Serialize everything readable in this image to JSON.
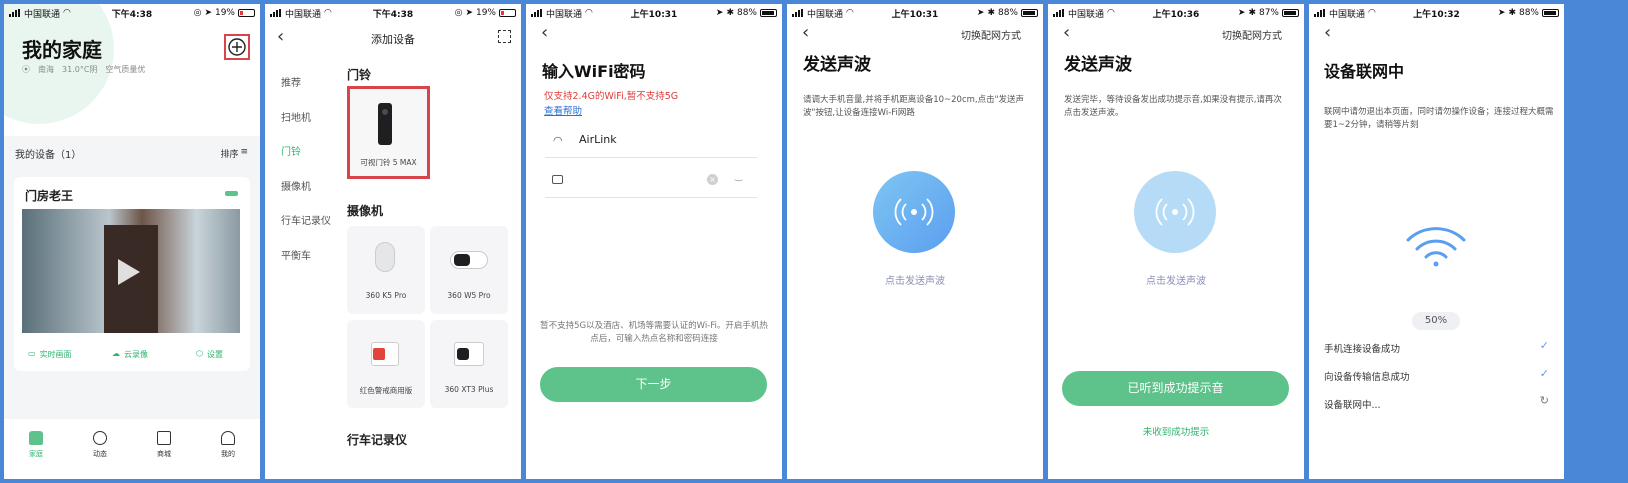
{
  "colors": {
    "accent": "#5ec38b",
    "green_text": "#2eb36e",
    "highlight": "#d9434a",
    "warning": "#e03a3a",
    "link": "#2f6fd1"
  },
  "p1": {
    "status": {
      "carrier": "中国联通",
      "time": "下午4:38",
      "battery": "19%"
    },
    "title": "我的家庭",
    "weather": {
      "city": "南海",
      "temp": "31.0°C阴",
      "air": "空气质量优"
    },
    "my_devices": "我的设备（1）",
    "sort": "排序",
    "device": {
      "name": "门房老王",
      "actions": [
        "实时画面",
        "云录像",
        "设置"
      ]
    },
    "nav": [
      "家庭",
      "动态",
      "商城",
      "我的"
    ]
  },
  "p2": {
    "status": {
      "carrier": "中国联通",
      "time": "下午4:38",
      "battery": "19%"
    },
    "title": "添加设备",
    "categories": [
      "推荐",
      "扫地机",
      "门铃",
      "摄像机",
      "行车记录仪",
      "平衡车"
    ],
    "sec_doorbell": "门铃",
    "doorbell": "可视门铃 5 MAX",
    "sec_camera": "摄像机",
    "cameras": [
      "360 K5 Pro",
      "360 W5 Pro",
      "红色警戒商用版",
      "360 XT3 Plus"
    ],
    "sec_dashcam": "行车记录仪"
  },
  "p3": {
    "status": {
      "carrier": "中国联通",
      "time": "上午10:31",
      "battery": "88%"
    },
    "title": "输入WiFi密码",
    "warn": "仅支持2.4G的WiFi,暂不支持5G",
    "help": "查看帮助",
    "ssid": "AirLink",
    "password": "",
    "note": "暂不支持5G以及酒店、机场等需要认证的Wi-Fi。开启手机热点后，可输入热点名称和密码连接",
    "next": "下一步"
  },
  "p4": {
    "status": {
      "carrier": "中国联通",
      "time": "上午10:31",
      "battery": "88%"
    },
    "switch": "切换配网方式",
    "title": "发送声波",
    "desc": "请调大手机音量,并将手机距离设备10~20cm,点击\"发送声波\"按钮,让设备连接Wi-Fi网路",
    "tap": "点击发送声波"
  },
  "p5": {
    "status": {
      "carrier": "中国联通",
      "time": "上午10:36",
      "battery": "87%"
    },
    "switch": "切换配网方式",
    "title": "发送声波",
    "desc": "发送完毕，等待设备发出成功提示音,如果没有提示,请再次点击发送声波。",
    "tap": "点击发送声波",
    "heard": "已听到成功提示音",
    "not_heard": "未收到成功提示"
  },
  "p6": {
    "status": {
      "carrier": "中国联通",
      "time": "上午10:32",
      "battery": "88%"
    },
    "title": "设备联网中",
    "desc": "联网中请勿退出本页面，同时请勿操作设备；连接过程大概需要1~2分钟，请稍等片刻",
    "progress_label": "50%",
    "progress": 0.5,
    "steps": [
      {
        "label": "手机连接设备成功",
        "state": "done"
      },
      {
        "label": "向设备传输信息成功",
        "state": "done"
      },
      {
        "label": "设备联网中...",
        "state": "loading"
      }
    ]
  }
}
